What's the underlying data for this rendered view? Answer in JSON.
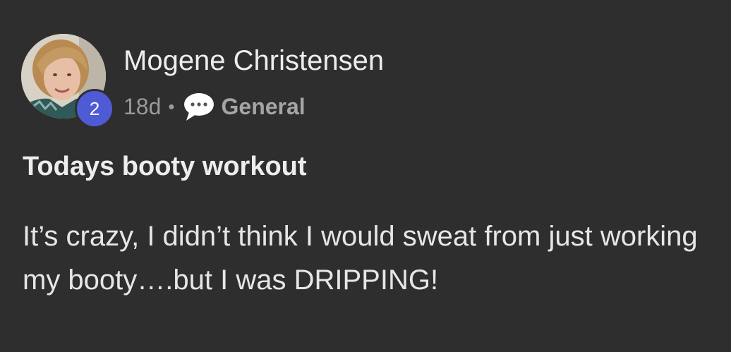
{
  "post": {
    "author": {
      "name": "Mogene Christensen",
      "level": "2"
    },
    "meta": {
      "time_ago": "18d",
      "separator": "•",
      "category": "General",
      "category_icon": "chat-bubble-icon"
    },
    "title": "Todays booty workout",
    "body": "It’s crazy, I didn’t think I would sweat from just working my booty….but I was DRIPPING!"
  },
  "colors": {
    "background": "#2e2e2e",
    "level_badge": "#4f5bd5",
    "primary_text": "#ededed",
    "secondary_text": "#9a9a9a"
  }
}
